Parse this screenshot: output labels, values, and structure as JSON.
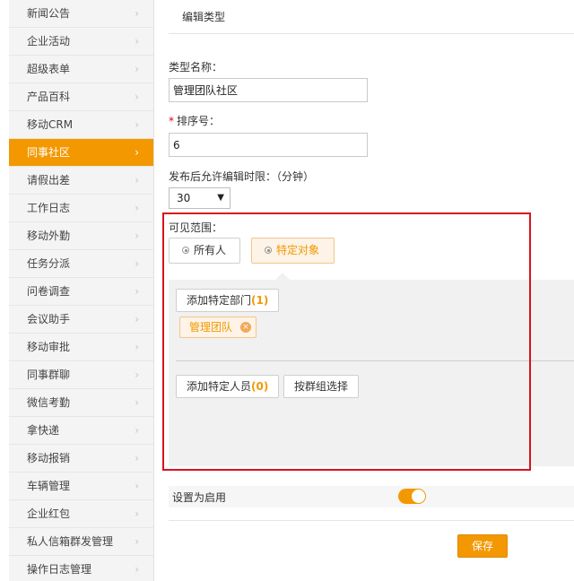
{
  "sidebar": {
    "items": [
      {
        "label": "新闻公告"
      },
      {
        "label": "企业活动"
      },
      {
        "label": "超级表单"
      },
      {
        "label": "产品百科"
      },
      {
        "label": "移动CRM"
      },
      {
        "label": "同事社区",
        "active": true
      },
      {
        "label": "请假出差"
      },
      {
        "label": "工作日志"
      },
      {
        "label": "移动外勤"
      },
      {
        "label": "任务分派"
      },
      {
        "label": "问卷调查"
      },
      {
        "label": "会议助手"
      },
      {
        "label": "移动审批"
      },
      {
        "label": "同事群聊"
      },
      {
        "label": "微信考勤"
      },
      {
        "label": "拿快递"
      },
      {
        "label": "移动报销"
      },
      {
        "label": "车辆管理"
      },
      {
        "label": "企业红包"
      },
      {
        "label": "私人信箱群发管理"
      },
      {
        "label": "操作日志管理"
      }
    ],
    "chevron": "›"
  },
  "header": {
    "title": "编辑类型"
  },
  "form": {
    "type_name_label": "类型名称：",
    "type_name_value": "管理团队社区",
    "sort_label": "排序号：",
    "required_mark": "*",
    "sort_value": "6",
    "time_limit_label": "发布后允许编辑时限：（分钟）",
    "time_limit_value": "30",
    "caret": "▼",
    "visibility_label": "可见范围：",
    "visibility_options": [
      {
        "label": "所有人",
        "selected": false
      },
      {
        "label": "特定对象",
        "selected": true
      }
    ],
    "add_dept_label": "添加特定部门",
    "add_dept_count": "(1)",
    "dept_tag": "管理团队",
    "tag_close": "×",
    "add_user_label": "添加特定人员",
    "add_user_count": "(0)",
    "group_select_label": "按群组选择",
    "enable_label": "设置为启用",
    "enabled": true,
    "save_label": "保存"
  },
  "colors": {
    "accent": "#f39800",
    "highlight": "#d9121e"
  }
}
